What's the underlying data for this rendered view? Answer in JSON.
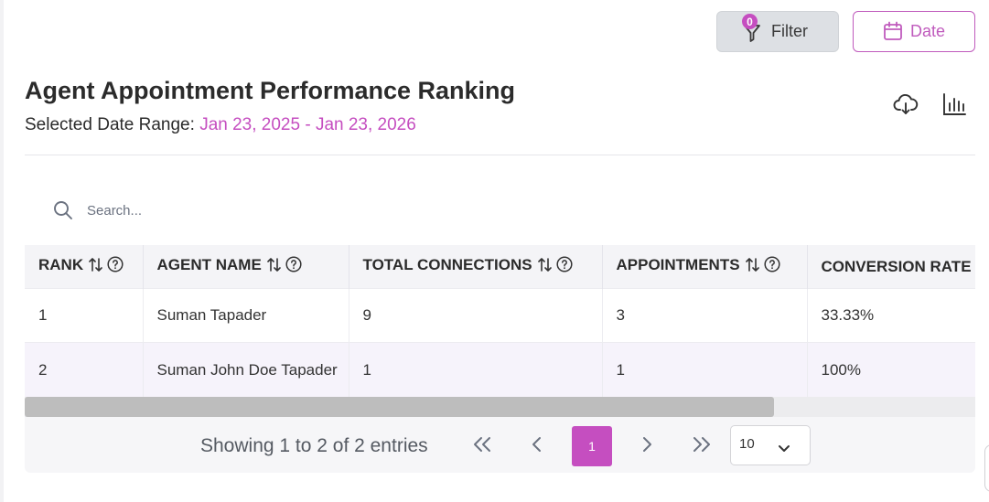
{
  "toolbar": {
    "filter_label": "Filter",
    "filter_badge": "0",
    "date_label": "Date"
  },
  "report": {
    "title": "Agent Appointment Performance Ranking",
    "date_range_label": "Selected Date Range:",
    "date_range_value": "Jan 23, 2025 - Jan 23, 2026"
  },
  "search": {
    "placeholder": "Search..."
  },
  "table": {
    "columns": [
      "RANK",
      "AGENT NAME",
      "TOTAL CONNECTIONS",
      "APPOINTMENTS",
      "CONVERSION RATE"
    ],
    "rows": [
      [
        "1",
        "Suman Tapader",
        "9",
        "3",
        "33.33%"
      ],
      [
        "2",
        "Suman John Doe Tapader",
        "1",
        "1",
        "100%"
      ]
    ]
  },
  "pagination": {
    "summary": "Showing 1 to 2 of 2 entries",
    "current_page": "1",
    "page_size": "10"
  },
  "colors": {
    "accent": "#c54ec0",
    "filter_bg": "#dde0e4",
    "header_bg": "#f4f4f7",
    "row_alt_bg": "#f6f3fb"
  },
  "icons": [
    "filter-icon",
    "calendar-icon",
    "download-cloud-icon",
    "bar-chart-icon",
    "search-icon",
    "sort-icon",
    "help-icon",
    "first-page-icon",
    "prev-page-icon",
    "next-page-icon",
    "last-page-icon",
    "chevron-down-icon"
  ]
}
